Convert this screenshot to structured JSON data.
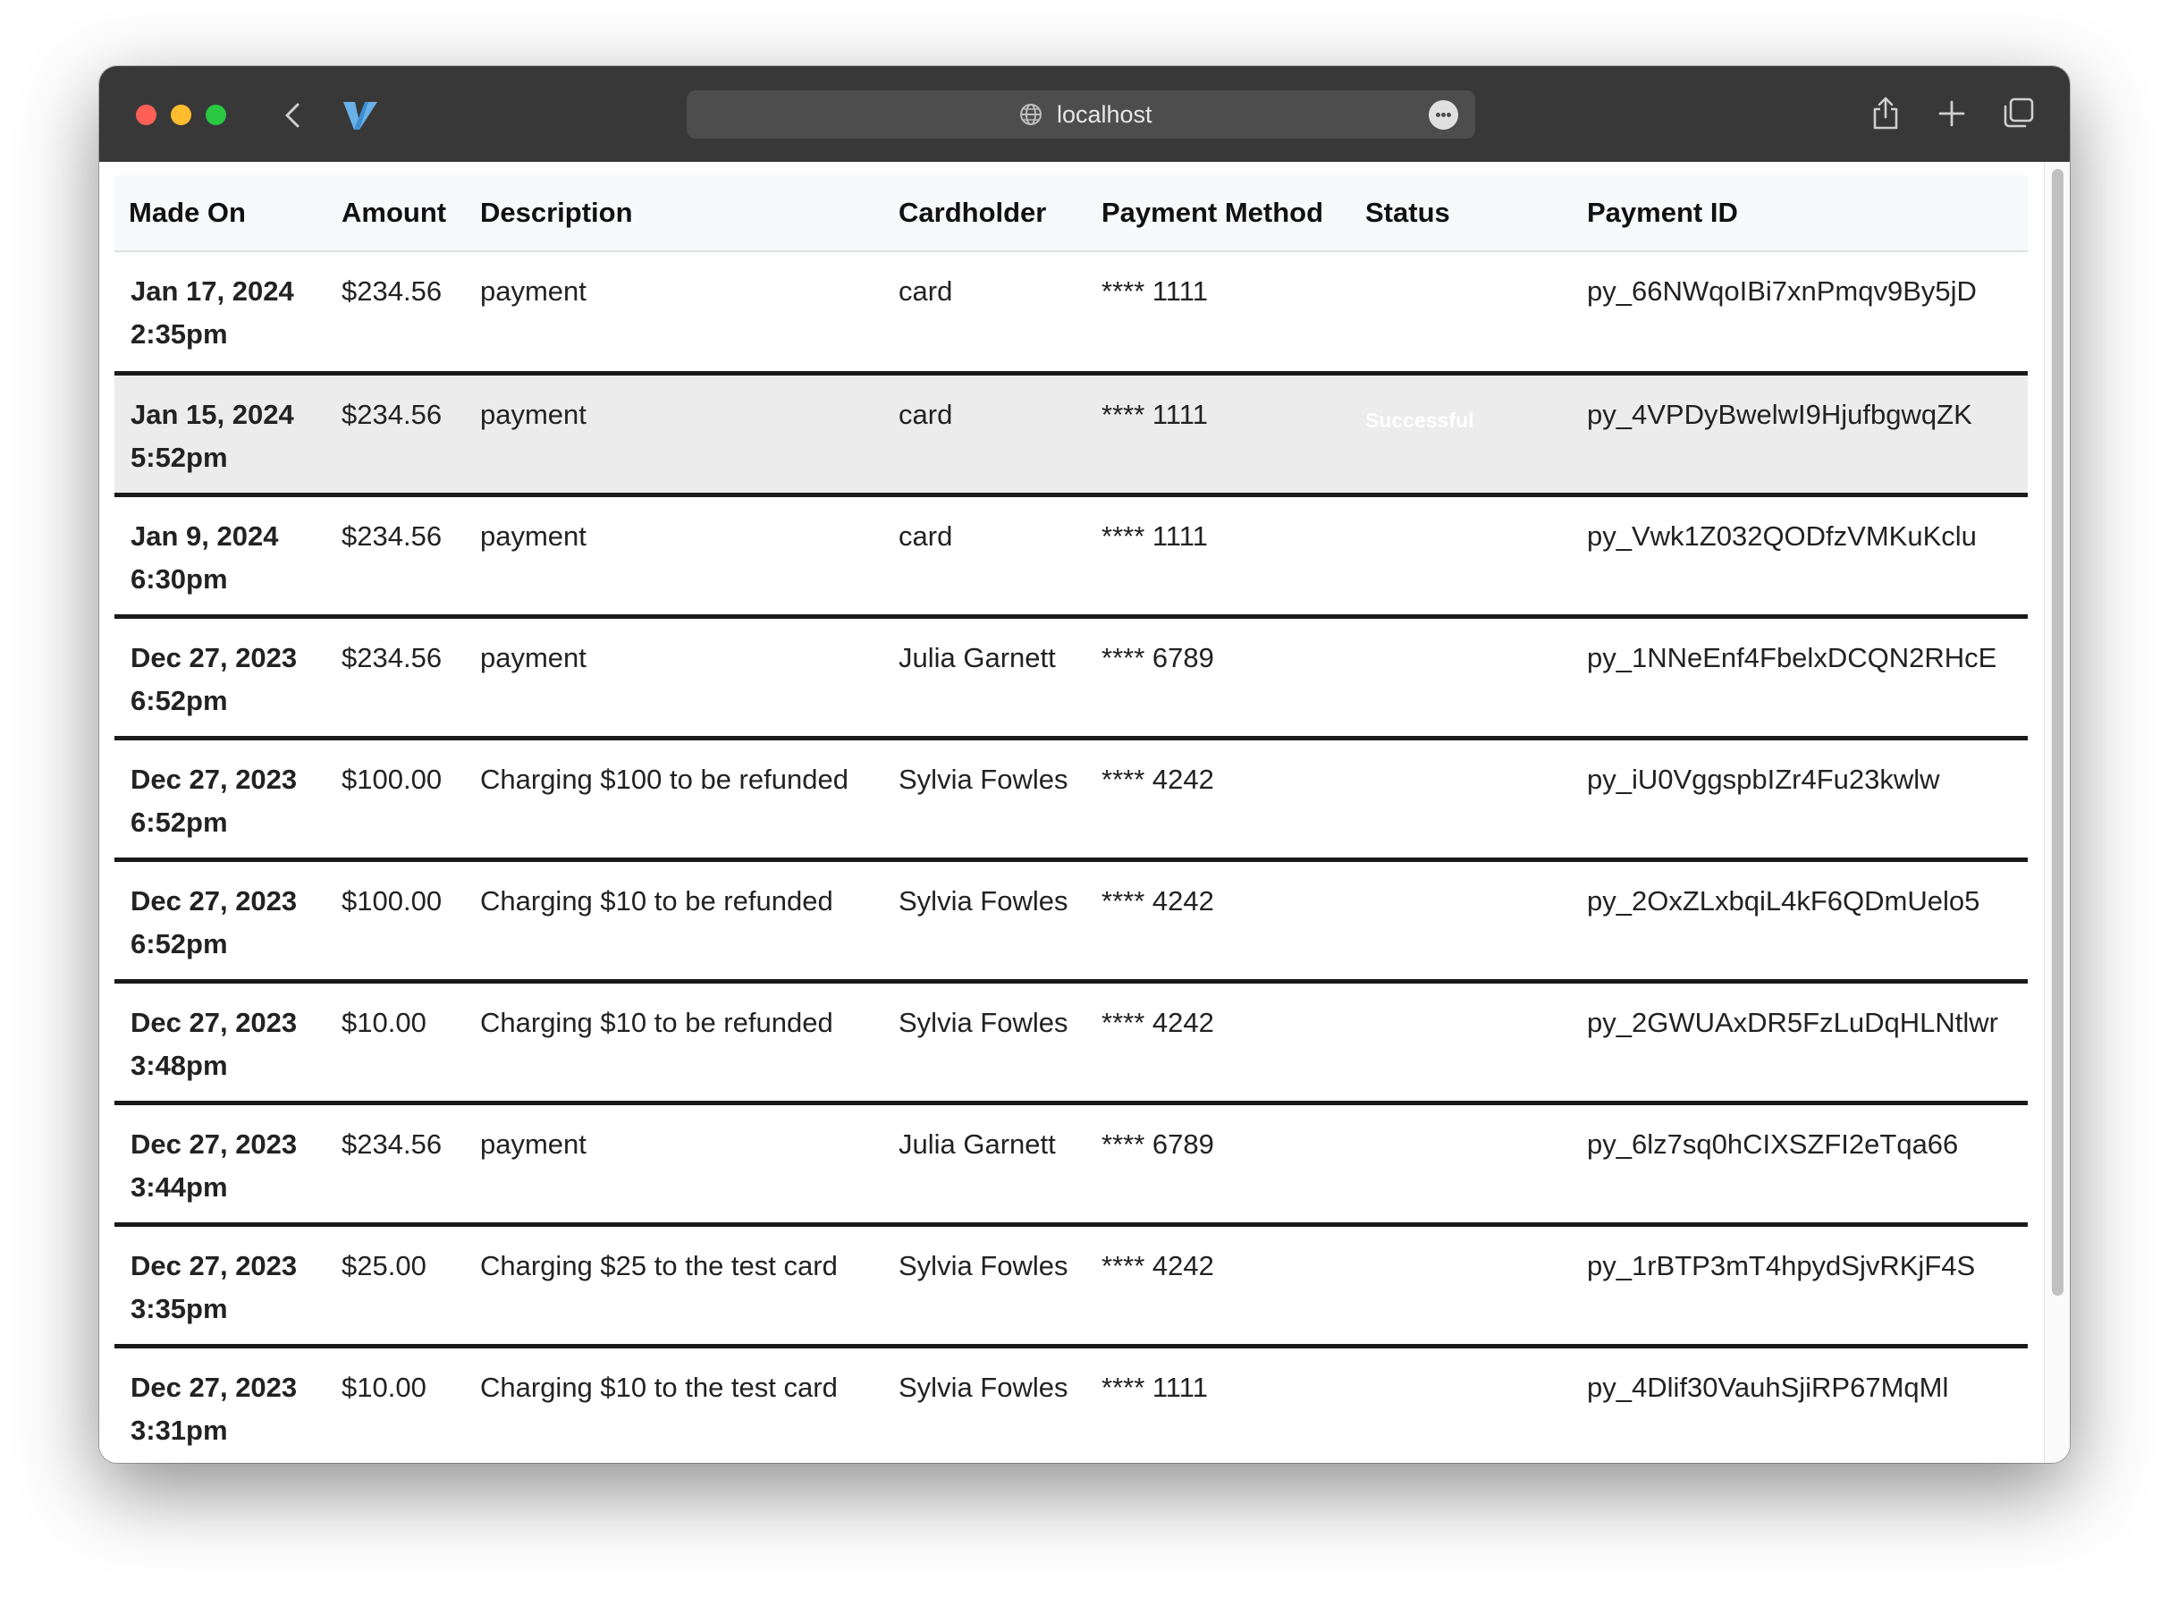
{
  "browser": {
    "url": "localhost"
  },
  "table": {
    "headers": [
      "Made On",
      "Amount",
      "Description",
      "Cardholder",
      "Payment Method",
      "Status",
      "Payment ID"
    ],
    "rows": [
      {
        "made_on_date": "Jan 17, 2024",
        "made_on_time": "2:35pm",
        "amount": "$234.56",
        "description": "payment",
        "cardholder": "card",
        "payment_method": "**** 1111",
        "status": "",
        "payment_id": "py_66NWqoIBi7xnPmqv9By5jD"
      },
      {
        "made_on_date": "Jan 15, 2024",
        "made_on_time": "5:52pm",
        "amount": "$234.56",
        "description": "payment",
        "cardholder": "card",
        "payment_method": "**** 1111",
        "status": "Successful",
        "payment_id": "py_4VPDyBwelwI9HjufbgwqZK"
      },
      {
        "made_on_date": "Jan 9, 2024",
        "made_on_time": "6:30pm",
        "amount": "$234.56",
        "description": "payment",
        "cardholder": "card",
        "payment_method": "**** 1111",
        "status": "",
        "payment_id": "py_Vwk1Z032QODfzVMKuKclu"
      },
      {
        "made_on_date": "Dec 27, 2023",
        "made_on_time": "6:52pm",
        "amount": "$234.56",
        "description": "payment",
        "cardholder": "Julia Garnett",
        "payment_method": "**** 6789",
        "status": "",
        "payment_id": "py_1NNeEnf4FbelxDCQN2RHcE"
      },
      {
        "made_on_date": "Dec 27, 2023",
        "made_on_time": "6:52pm",
        "amount": "$100.00",
        "description": "Charging $100 to be refunded",
        "cardholder": "Sylvia Fowles",
        "payment_method": "**** 4242",
        "status": "",
        "payment_id": "py_iU0VggspbIZr4Fu23kwlw"
      },
      {
        "made_on_date": "Dec 27, 2023",
        "made_on_time": "6:52pm",
        "amount": "$100.00",
        "description": "Charging $10 to be refunded",
        "cardholder": "Sylvia Fowles",
        "payment_method": "**** 4242",
        "status": "",
        "payment_id": "py_2OxZLxbqiL4kF6QDmUelo5"
      },
      {
        "made_on_date": "Dec 27, 2023",
        "made_on_time": "3:48pm",
        "amount": "$10.00",
        "description": "Charging $10 to be refunded",
        "cardholder": "Sylvia Fowles",
        "payment_method": "**** 4242",
        "status": "",
        "payment_id": "py_2GWUAxDR5FzLuDqHLNtlwr"
      },
      {
        "made_on_date": "Dec 27, 2023",
        "made_on_time": "3:44pm",
        "amount": "$234.56",
        "description": "payment",
        "cardholder": "Julia Garnett",
        "payment_method": "**** 6789",
        "status": "",
        "payment_id": "py_6lz7sq0hCIXSZFI2eTqa66"
      },
      {
        "made_on_date": "Dec 27, 2023",
        "made_on_time": "3:35pm",
        "amount": "$25.00",
        "description": "Charging $25 to the test card",
        "cardholder": "Sylvia Fowles",
        "payment_method": "**** 4242",
        "status": "",
        "payment_id": "py_1rBTP3mT4hpydSjvRKjF4S"
      },
      {
        "made_on_date": "Dec 27, 2023",
        "made_on_time": "3:31pm",
        "amount": "$10.00",
        "description": "Charging $10 to the test card",
        "cardholder": "Sylvia Fowles",
        "payment_method": "**** 1111",
        "status": "",
        "payment_id": "py_4Dlif30VauhSjiRP67MqMl"
      }
    ]
  }
}
